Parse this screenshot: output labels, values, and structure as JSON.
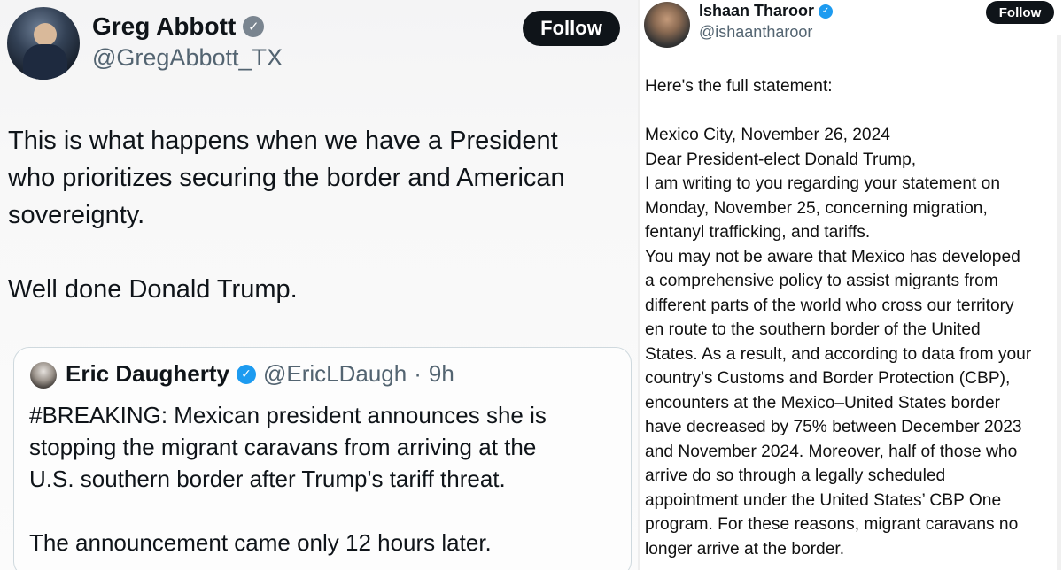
{
  "left_tweet": {
    "author_name": "Greg Abbott",
    "author_handle": "@GregAbbott_TX",
    "follow_label": "Follow",
    "text_lines": [
      "This is what happens when we have a President",
      "who prioritizes securing the border and American",
      "sovereignty.",
      "",
      "Well done Donald Trump."
    ],
    "quote": {
      "author_name": "Eric Daugherty",
      "author_handle": "@EricLDaugh",
      "separator": "·",
      "time": "9h",
      "text_lines": [
        "#BREAKING: Mexican president announces she is",
        "stopping the migrant caravans from arriving at the",
        "U.S. southern border after Trump's tariff threat.",
        "",
        "The announcement came only 12 hours later."
      ]
    }
  },
  "right_tweet": {
    "author_name": "Ishaan Tharoor",
    "author_handle": "@ishaantharoor",
    "follow_label": "Follow",
    "text_lines": [
      "Here's the full statement:",
      "",
      "Mexico City, November 26, 2024",
      "Dear President-elect Donald Trump,",
      "I am writing to you regarding your statement on",
      "Monday, November 25, concerning migration,",
      "fentanyl trafficking, and tariffs.",
      "You may not be aware that Mexico has developed",
      "a comprehensive policy to assist migrants from",
      "different parts of the world who cross our territory",
      "en route to the southern border of the United",
      "States. As a result, and according to data from your",
      "country’s Customs and Border Protection (CBP),",
      "encounters at the Mexico–United States border",
      "have decreased by 75% between December 2023",
      "and November 2024. Moreover, half of those who",
      "arrive do so through a legally scheduled",
      "appointment under the United States’ CBP One",
      "program. For these reasons, migrant caravans no",
      "longer arrive at the border."
    ]
  },
  "icons": {
    "verified_grey": "verified-badge-grey",
    "verified_blue": "verified-badge-blue",
    "check_glyph": "✓"
  },
  "colors": {
    "follow_bg": "#0f1419",
    "handle_grey": "#536471",
    "verified_blue": "#1d9bf0",
    "verified_grey": "#7a8590"
  }
}
